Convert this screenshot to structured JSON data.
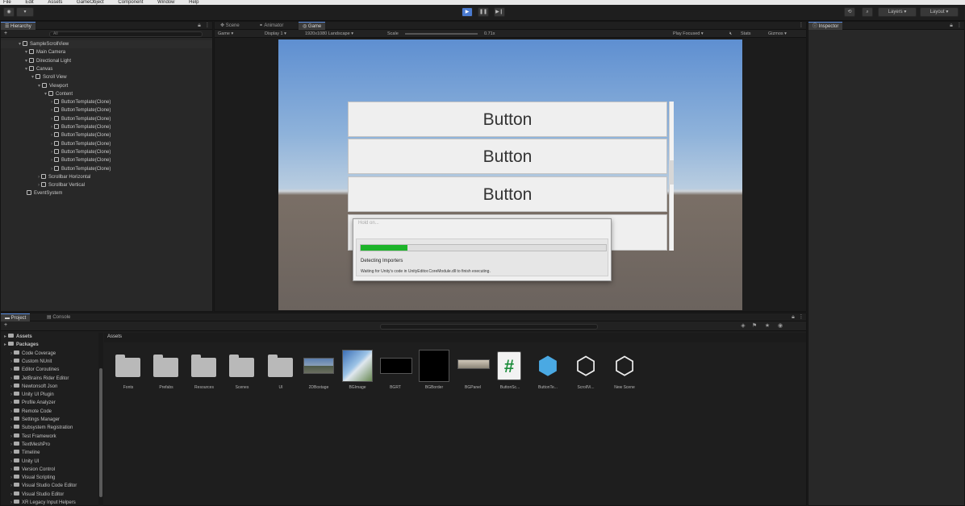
{
  "menu": {
    "items": [
      "File",
      "Edit",
      "Assets",
      "GameObject",
      "Component",
      "Window",
      "Help"
    ]
  },
  "toolbar": {
    "account_label": "",
    "layers_label": "Layers",
    "layout_label": "Layout",
    "play_icon": "play-icon",
    "pause_icon": "pause-icon",
    "step_icon": "step-icon"
  },
  "hierarchy": {
    "tab_label": "Hierarchy",
    "add_label": "+",
    "search_placeholder": "All",
    "items": [
      {
        "label": "SampleScrollView",
        "depth": 0,
        "kind": "scene"
      },
      {
        "label": "Main Camera",
        "depth": 1
      },
      {
        "label": "Directional Light",
        "depth": 1
      },
      {
        "label": "Canvas",
        "depth": 1
      },
      {
        "label": "Scroll View",
        "depth": 2
      },
      {
        "label": "Viewport",
        "depth": 3
      },
      {
        "label": "Content",
        "depth": 4
      },
      {
        "label": "ButtonTemplate(Clone)",
        "depth": 5
      },
      {
        "label": "ButtonTemplate(Clone)",
        "depth": 5
      },
      {
        "label": "ButtonTemplate(Clone)",
        "depth": 5
      },
      {
        "label": "ButtonTemplate(Clone)",
        "depth": 5
      },
      {
        "label": "ButtonTemplate(Clone)",
        "depth": 5
      },
      {
        "label": "ButtonTemplate(Clone)",
        "depth": 5
      },
      {
        "label": "ButtonTemplate(Clone)",
        "depth": 5
      },
      {
        "label": "ButtonTemplate(Clone)",
        "depth": 5
      },
      {
        "label": "ButtonTemplate(Clone)",
        "depth": 5
      },
      {
        "label": "Scrollbar Horizontal",
        "depth": 3
      },
      {
        "label": "Scrollbar Vertical",
        "depth": 3
      },
      {
        "label": "EventSystem",
        "depth": 1
      }
    ]
  },
  "center": {
    "tabs": [
      {
        "label": "Scene",
        "selected": false
      },
      {
        "label": "Animator",
        "selected": false
      },
      {
        "label": "Game",
        "selected": true
      }
    ],
    "game_bar": {
      "display": "Game",
      "display_num": "Display 1",
      "resolution": "1920x1080 Landscape",
      "scale_label": "Scale",
      "scale_value": "0.71x",
      "play_focused": "Play Focused",
      "stats": "Stats",
      "gizmos": "Gizmos"
    },
    "buttons": [
      "Button",
      "Button",
      "Button",
      ""
    ]
  },
  "dialog": {
    "title": "Hold on...",
    "progress": 0.19,
    "status": "Detecting Importers",
    "detail": "Waiting for Unity's code in UnityEditor.CoreModule.dll to finish executing."
  },
  "inspector": {
    "tab_label": "Inspector"
  },
  "project": {
    "tabs": [
      {
        "label": "Project",
        "selected": true
      },
      {
        "label": "Console",
        "selected": false
      }
    ],
    "add_label": "+",
    "breadcrumb": "Assets",
    "badge": "",
    "tree": [
      {
        "label": "Assets",
        "depth": 0,
        "bold": true
      },
      {
        "label": "Packages",
        "depth": 0,
        "bold": true
      },
      {
        "label": "Code Coverage",
        "depth": 1
      },
      {
        "label": "Custom NUnit",
        "depth": 1
      },
      {
        "label": "Editor Coroutines",
        "depth": 1
      },
      {
        "label": "JetBrains Rider Editor",
        "depth": 1
      },
      {
        "label": "Newtonsoft Json",
        "depth": 1
      },
      {
        "label": "Unity UI Plugin",
        "depth": 1
      },
      {
        "label": "Profile Analyzer",
        "depth": 1
      },
      {
        "label": "Remote Code",
        "depth": 1
      },
      {
        "label": "Settings Manager",
        "depth": 1
      },
      {
        "label": "Subsystem Registration",
        "depth": 1
      },
      {
        "label": "Test Framework",
        "depth": 1
      },
      {
        "label": "TextMeshPro",
        "depth": 1
      },
      {
        "label": "Timeline",
        "depth": 1
      },
      {
        "label": "Unity UI",
        "depth": 1
      },
      {
        "label": "Version Control",
        "depth": 1
      },
      {
        "label": "Visual Scripting",
        "depth": 1
      },
      {
        "label": "Visual Studio Code Editor",
        "depth": 1
      },
      {
        "label": "Visual Studio Editor",
        "depth": 1
      },
      {
        "label": "XR Legacy Input Helpers",
        "depth": 1
      }
    ],
    "assets": [
      {
        "label": "Fonts",
        "kind": "folder"
      },
      {
        "label": "Prefabs",
        "kind": "folder"
      },
      {
        "label": "Resources",
        "kind": "folder"
      },
      {
        "label": "Scenes",
        "kind": "folder"
      },
      {
        "label": "UI",
        "kind": "folder"
      },
      {
        "label": "2DBoxtage",
        "kind": "image-landscape"
      },
      {
        "label": "BGImage",
        "kind": "image-sky"
      },
      {
        "label": "BGRT",
        "kind": "image-black"
      },
      {
        "label": "BGBorder",
        "kind": "image-black-square"
      },
      {
        "label": "BGPanel",
        "kind": "image-panel"
      },
      {
        "label": "ButtonSc...",
        "kind": "script"
      },
      {
        "label": "ButtonTe...",
        "kind": "prefab"
      },
      {
        "label": "ScrollVi...",
        "kind": "unity-scene"
      },
      {
        "label": "New Scene",
        "kind": "unity-scene"
      }
    ]
  }
}
